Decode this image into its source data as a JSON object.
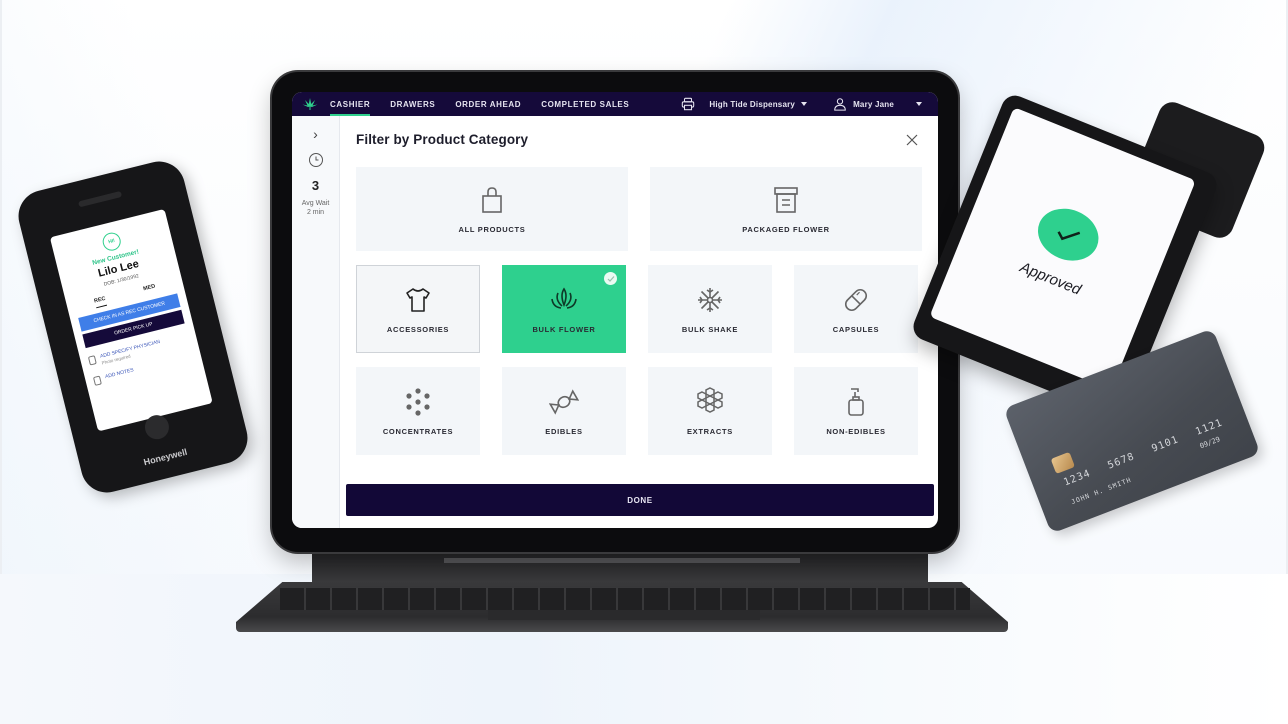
{
  "app": {
    "nav": {
      "tabs": [
        {
          "label": "CASHIER",
          "active": true
        },
        {
          "label": "DRAWERS",
          "active": false
        },
        {
          "label": "ORDER AHEAD",
          "active": false
        },
        {
          "label": "COMPLETED SALES",
          "active": false
        }
      ],
      "store": "High Tide Dispensary",
      "user": "Mary Jane",
      "logo_icon": "cannabis-leaf-icon",
      "printer_icon": "printer-icon",
      "user_icon": "user-icon"
    },
    "sidebar": {
      "expand_icon": "chevron-right-icon",
      "clock_icon": "clock-icon",
      "queue_count": "3",
      "wait_label": "Avg Wait",
      "wait_value": "2 min"
    },
    "modal": {
      "title": "Filter by Product Category",
      "close_icon": "close-icon",
      "categories": [
        {
          "label": "ALL PRODUCTS",
          "icon": "shopping-bag-icon",
          "selected": false
        },
        {
          "label": "PACKAGED FLOWER",
          "icon": "archive-box-icon",
          "selected": false
        },
        {
          "label": "ACCESSORIES",
          "icon": "tshirt-icon",
          "selected": false,
          "focused": true
        },
        {
          "label": "BULK FLOWER",
          "icon": "lotus-flower-icon",
          "selected": true
        },
        {
          "label": "BULK SHAKE",
          "icon": "snowflake-icon",
          "selected": false
        },
        {
          "label": "CAPSULES",
          "icon": "capsule-icon",
          "selected": false
        },
        {
          "label": "CONCENTRATES",
          "icon": "dots-cluster-icon",
          "selected": false
        },
        {
          "label": "EDIBLES",
          "icon": "candy-icon",
          "selected": false
        },
        {
          "label": "EXTRACTS",
          "icon": "honeycomb-icon",
          "selected": false
        },
        {
          "label": "NON-EDIBLES",
          "icon": "pump-bottle-icon",
          "selected": false
        }
      ],
      "done_label": "DONE"
    },
    "colors": {
      "nav_bg": "#150a3a",
      "accent_green": "#2ed08e",
      "done_bg": "#120837",
      "tile_bg": "#f3f6f9"
    }
  },
  "phone": {
    "badge": "HI!",
    "greeting": "New Customer!",
    "name": "Lilo Lee",
    "dob": "DOB: 1/30/1992",
    "tabs": [
      "REC",
      "MED"
    ],
    "primary_button": "CHECK IN AS REC CUSTOMER",
    "secondary_button": "ORDER PICK UP",
    "rows": [
      {
        "title": "ADD SPECIFY PHYSICIAN",
        "sub": "Photo required"
      },
      {
        "title": "ADD NOTES",
        "sub": ""
      }
    ],
    "brand": "Honeywell"
  },
  "terminal": {
    "status": "Approved",
    "status_icon": "checkmark-icon"
  },
  "card": {
    "number": "1234 5678 9101 1121",
    "expiry": "09/29",
    "holder": "JOHN H. SMITH"
  }
}
